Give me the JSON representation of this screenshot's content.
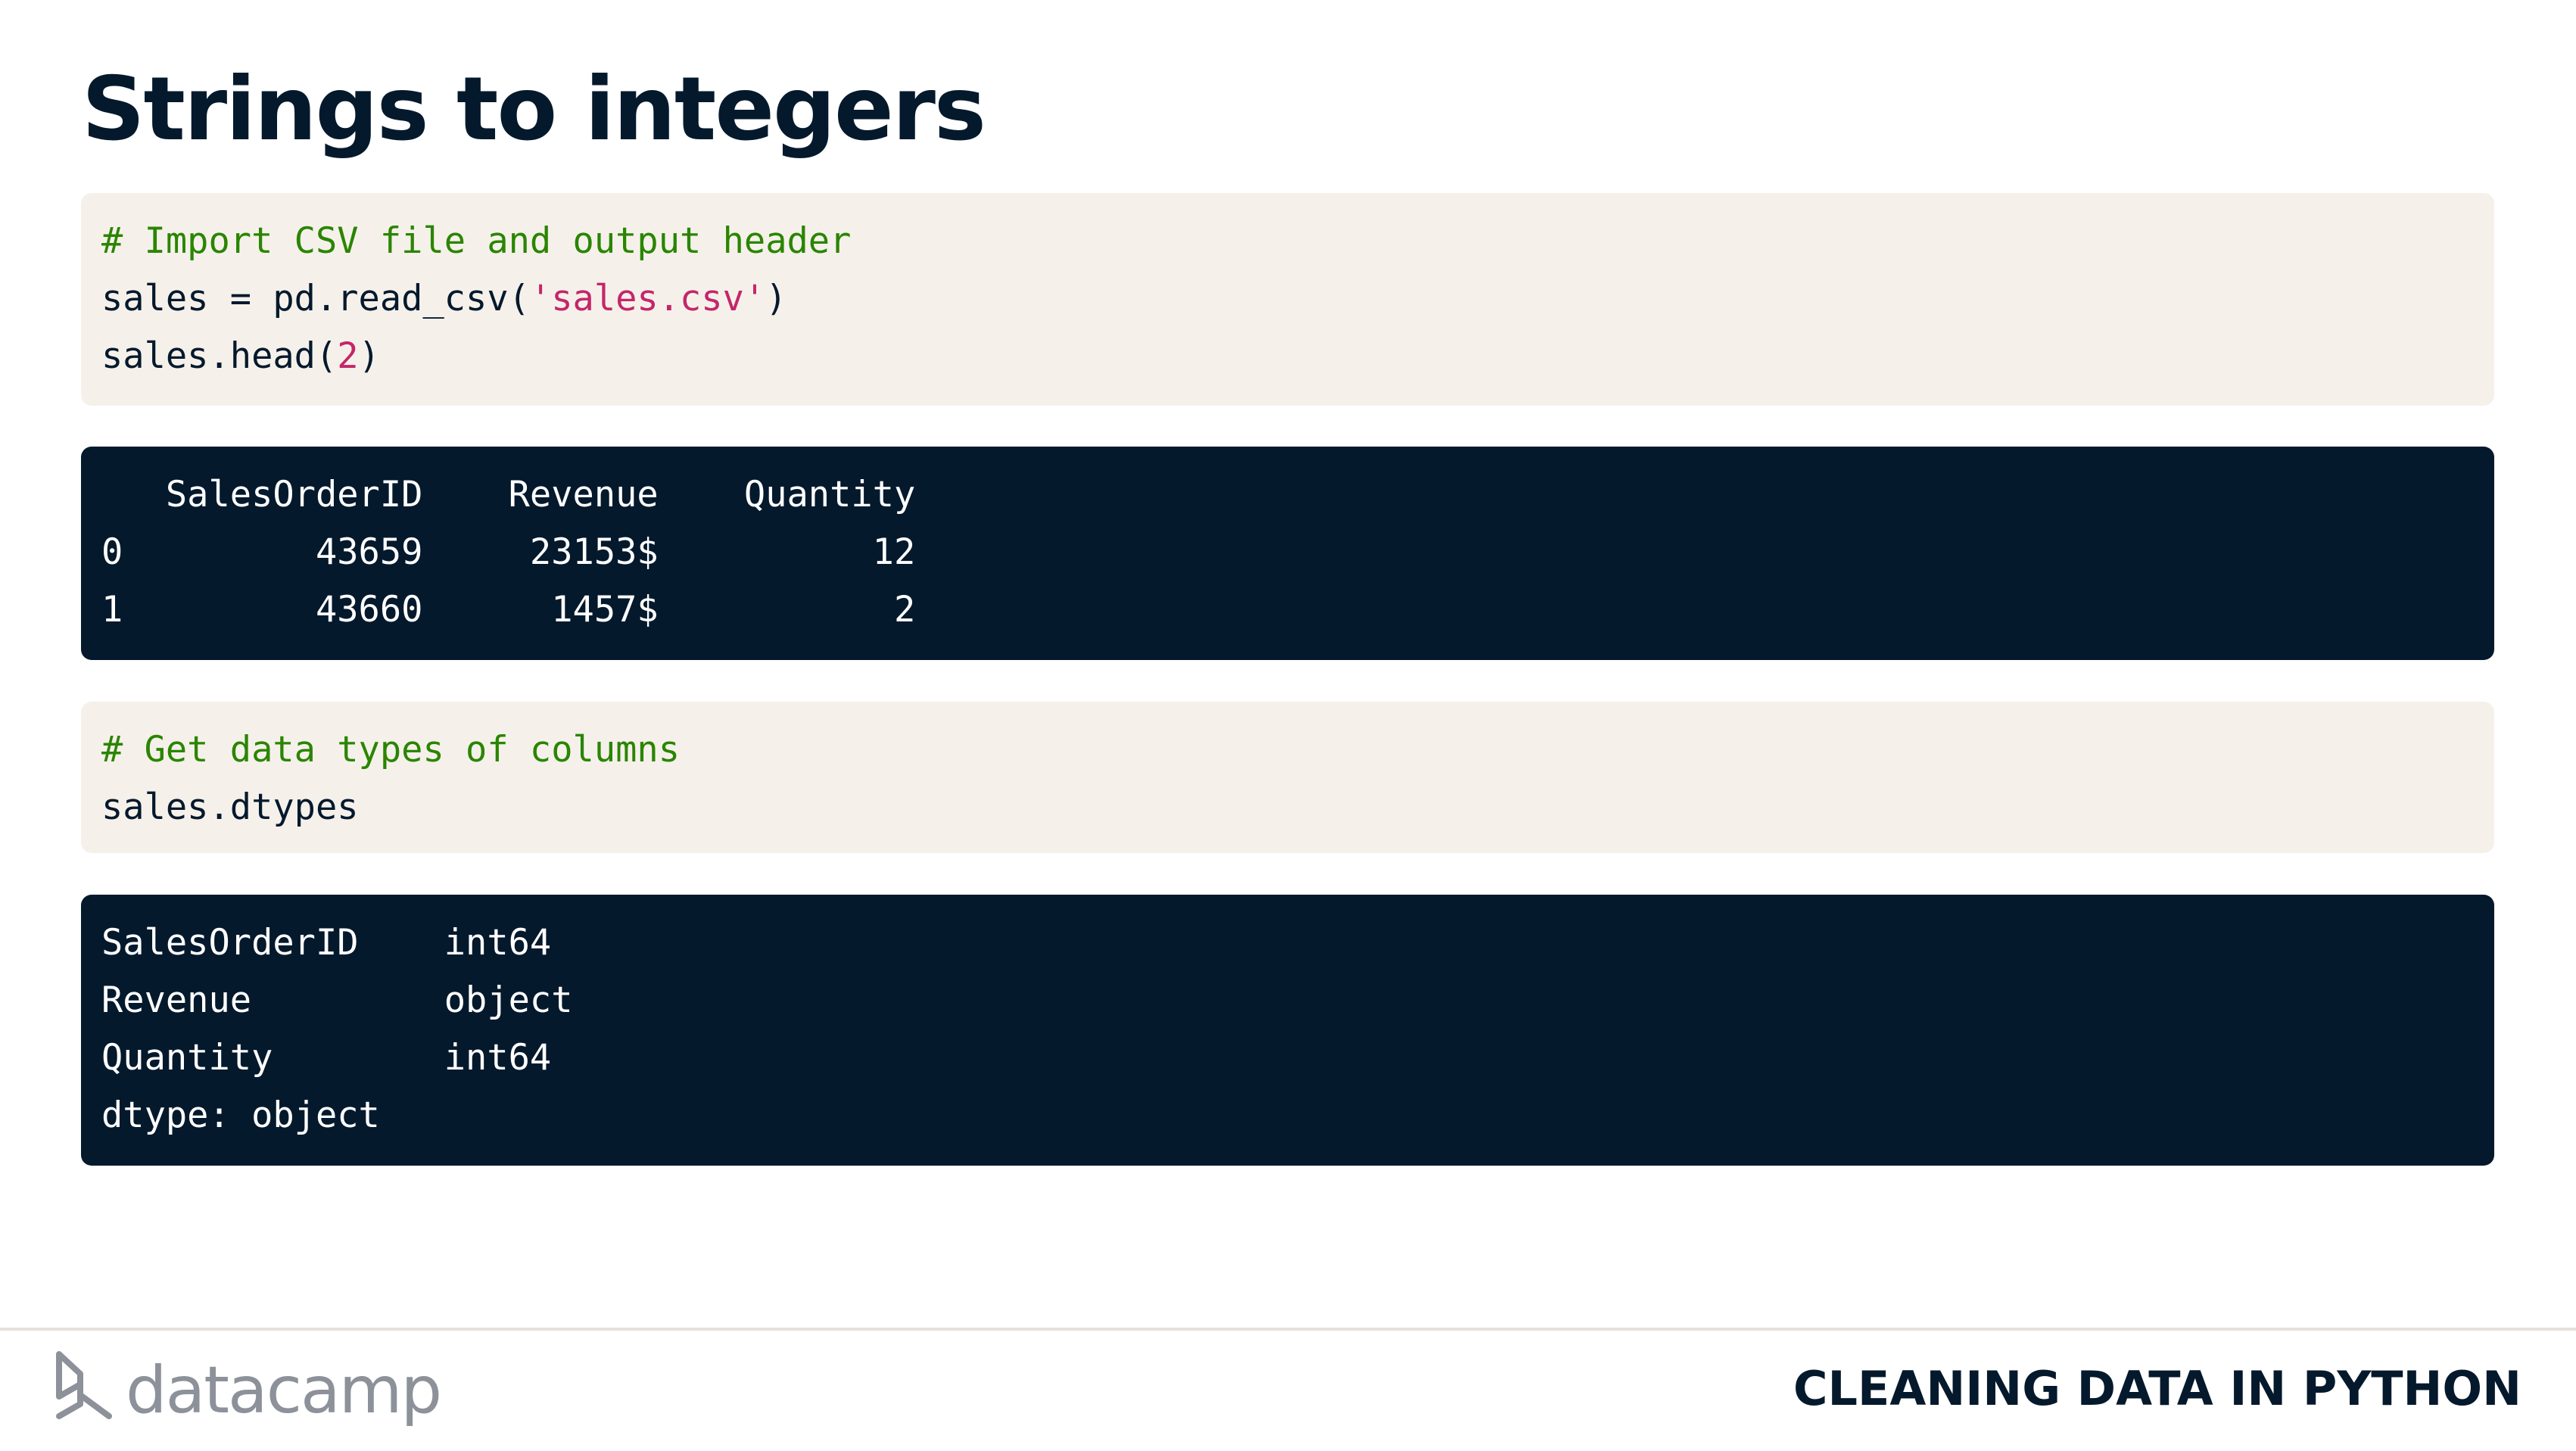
{
  "slide": {
    "title": "Strings to integers"
  },
  "code_blocks": [
    {
      "kind": "input",
      "lines": [
        [
          {
            "t": "# Import CSV file and output header",
            "c": "comment"
          }
        ],
        [
          {
            "t": "sales = pd.read_csv(",
            "c": ""
          },
          {
            "t": "'sales.csv'",
            "c": "string"
          },
          {
            "t": ")",
            "c": ""
          }
        ],
        [
          {
            "t": "sales.head(",
            "c": ""
          },
          {
            "t": "2",
            "c": "number"
          },
          {
            "t": ")",
            "c": ""
          }
        ]
      ]
    },
    {
      "kind": "output",
      "lines": [
        [
          {
            "t": "   SalesOrderID    Revenue    Quantity",
            "c": ""
          }
        ],
        [
          {
            "t": "0         43659     23153$          12",
            "c": ""
          }
        ],
        [
          {
            "t": "1         43660      1457$           2",
            "c": ""
          }
        ]
      ]
    },
    {
      "kind": "input",
      "lines": [
        [
          {
            "t": "# Get data types of columns",
            "c": "comment"
          }
        ],
        [
          {
            "t": "sales.dtypes",
            "c": ""
          }
        ]
      ]
    },
    {
      "kind": "output",
      "lines": [
        [
          {
            "t": "SalesOrderID    int64",
            "c": ""
          }
        ],
        [
          {
            "t": "Revenue         object",
            "c": ""
          }
        ],
        [
          {
            "t": "Quantity        int64",
            "c": ""
          }
        ],
        [
          {
            "t": "dtype: object",
            "c": ""
          }
        ]
      ]
    }
  ],
  "footer": {
    "brand_name": "datacamp",
    "brand_icon": "datacamp-logo-icon",
    "course_title": "CLEANING DATA IN PYTHON"
  },
  "colors": {
    "text_dark": "#05192d",
    "code_input_bg": "#f5f1ea",
    "code_output_bg": "#05192d",
    "comment": "#2a8500",
    "string": "#c4266a",
    "brand_gray": "#8d9199"
  }
}
